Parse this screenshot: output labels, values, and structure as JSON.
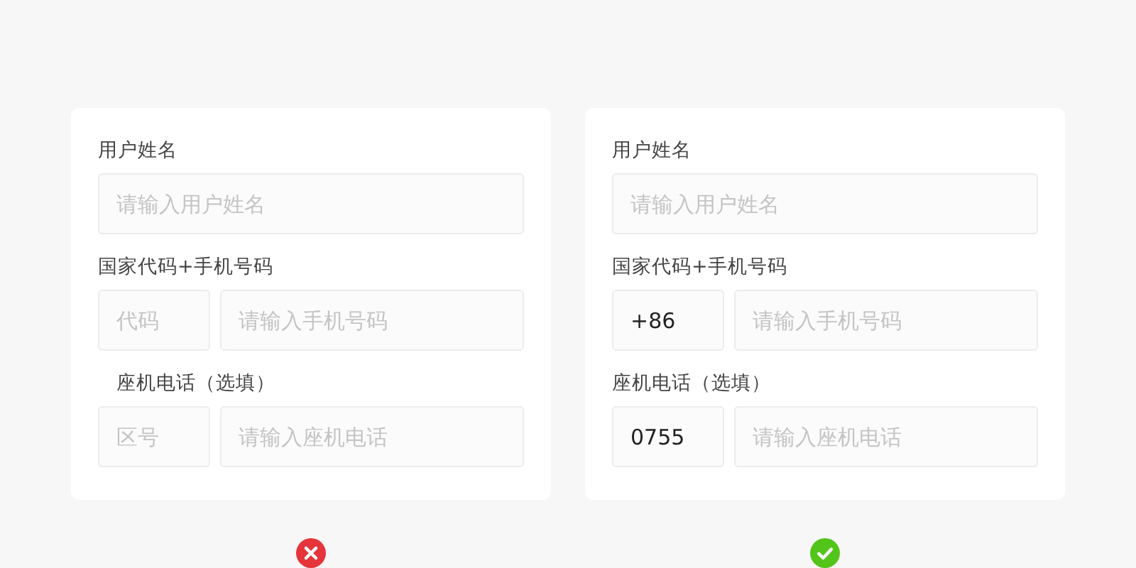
{
  "examples": [
    {
      "kind": "bad",
      "groups": [
        {
          "label": "用户姓名",
          "label_indented": false,
          "fields": [
            {
              "kind": "wide",
              "placeholder": "请输入用户姓名"
            }
          ]
        },
        {
          "label": "国家代码+手机号码",
          "label_indented": false,
          "fields": [
            {
              "kind": "short",
              "placeholder": "代码"
            },
            {
              "kind": "wide",
              "placeholder": "请输入手机号码"
            }
          ]
        },
        {
          "label": "座机电话（选填）",
          "label_indented": true,
          "fields": [
            {
              "kind": "short",
              "placeholder": "区号"
            },
            {
              "kind": "wide",
              "placeholder": "请输入座机电话"
            }
          ]
        }
      ]
    },
    {
      "kind": "good",
      "groups": [
        {
          "label": "用户姓名",
          "label_indented": false,
          "fields": [
            {
              "kind": "wide",
              "placeholder": "请输入用户姓名"
            }
          ]
        },
        {
          "label": "国家代码+手机号码",
          "label_indented": false,
          "fields": [
            {
              "kind": "short",
              "value": "+86"
            },
            {
              "kind": "wide",
              "placeholder": "请输入手机号码"
            }
          ]
        },
        {
          "label": "座机电话（选填）",
          "label_indented": false,
          "fields": [
            {
              "kind": "short",
              "value": "0755"
            },
            {
              "kind": "wide",
              "placeholder": "请输入座机电话"
            }
          ]
        }
      ]
    }
  ]
}
